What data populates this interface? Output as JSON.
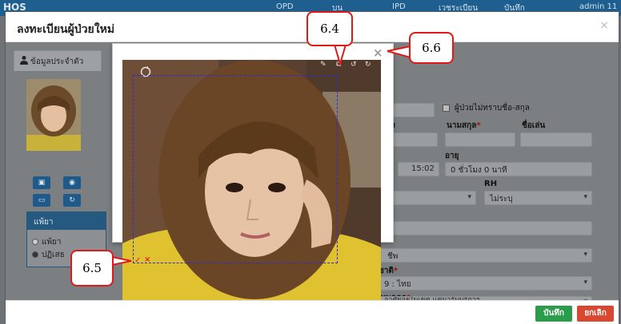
{
  "navbar": {
    "brand": "HOS",
    "items": [
      "OPD",
      "บน",
      "IPD",
      "เวชระเบียน",
      "บันทึก",
      "admin 11"
    ]
  },
  "registration_modal": {
    "title": "ลงทะเบียนผู้ป่วยใหม่",
    "close_glyph": "×",
    "tab_label": "ข้อมูลประจำตัว",
    "allergy": {
      "title": "แพ้ยา",
      "options": [
        "แพ้ยา",
        "ปฏิเสธ"
      ],
      "selected": "ปฏิเสธ"
    },
    "form": {
      "unknown_name_label": "ผู้ป่วยไม่ทราบชื่อ-สกุล",
      "first_name_partial": "ง",
      "lastname_label": "นามสกุล",
      "nickname_label": "ชื่อเล่น",
      "age_label": "อายุ",
      "time_value": "15:02",
      "age_value": "0 ชั่วโมง 0 นาที",
      "blood_partial": "ล",
      "rh_label": "RH",
      "rh_value": "ไม่ระบุ",
      "occupation_partial": "ชีพ",
      "nationality_label_partial": "ชาติ",
      "nationality_value": "9 : ไทย",
      "person_type_label_partial": "ภทบุคคล",
      "person_type_value": "อาศัยอยู่ในเขต แต่มารับบริการ"
    },
    "footer": {
      "save_label": "บันทึก",
      "cancel_label": "ยกเลิก"
    }
  },
  "crop_dialog": {
    "close_glyph": "×",
    "confirm_glyph": "✓",
    "cancel_glyph": "×"
  },
  "callouts": {
    "top": "6.4",
    "right": "6.6",
    "left": "6.5"
  },
  "colors": {
    "navbar": "#1f5f8f",
    "callout_border": "#e01818",
    "crop_border": "#2b2bd8",
    "save_button": "#2a9d4a",
    "cancel_button": "#d9472f"
  }
}
